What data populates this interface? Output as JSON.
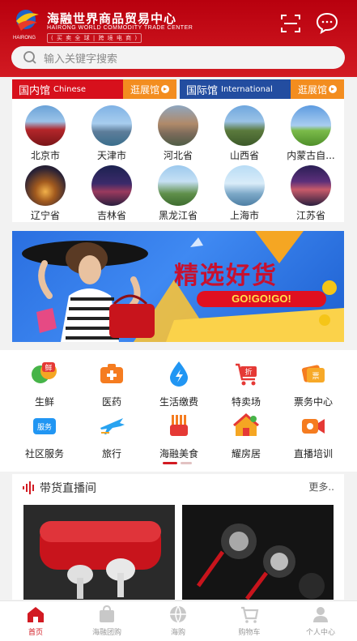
{
  "header": {
    "brand_cn": "海融世界商品贸易中心",
    "brand_en": "HAIRONG WORLD COMMODITY TRADE CENTER",
    "slogan": "( 买 卖 全 球  |  跨 境 电 商 )",
    "logo_text": "HAIRONG"
  },
  "search": {
    "placeholder": "输入关键字搜索"
  },
  "pavilions": {
    "domestic": {
      "name": "国内馆",
      "name_en": "Chinese",
      "action": "逛展馆"
    },
    "international": {
      "name": "国际馆",
      "name_en": "International",
      "action": "逛展馆"
    }
  },
  "cities": [
    {
      "label": "北京市",
      "icon": "tiananmen-photo"
    },
    {
      "label": "天津市",
      "icon": "tianjin-skyline-photo"
    },
    {
      "label": "河北省",
      "icon": "hebei-city-photo"
    },
    {
      "label": "山西省",
      "icon": "shanxi-temple-photo"
    },
    {
      "label": "内蒙古自...",
      "icon": "grassland-photo"
    },
    {
      "label": "辽宁省",
      "icon": "liaoning-night-photo"
    },
    {
      "label": "吉林省",
      "icon": "jilin-night-photo"
    },
    {
      "label": "黑龙江省",
      "icon": "pagoda-photo"
    },
    {
      "label": "上海市",
      "icon": "shanghai-tower-photo"
    },
    {
      "label": "江苏省",
      "icon": "jiangsu-night-photo"
    }
  ],
  "banner": {
    "title": "精选好货",
    "subtitle": "GO!GO!GO!"
  },
  "services": [
    {
      "label": "生鲜",
      "icon": "fresh-food-icon",
      "badge": "鲜"
    },
    {
      "label": "医药",
      "icon": "medicine-icon"
    },
    {
      "label": "生活缴费",
      "icon": "utility-payment-icon"
    },
    {
      "label": "特卖场",
      "icon": "flash-sale-icon",
      "badge": "折"
    },
    {
      "label": "票务中心",
      "icon": "ticket-icon",
      "badge": "票"
    },
    {
      "label": "社区服务",
      "icon": "community-service-icon",
      "badge": "服务"
    },
    {
      "label": "旅行",
      "icon": "airplane-icon"
    },
    {
      "label": "海融美食",
      "icon": "food-icon"
    },
    {
      "label": "耀房居",
      "icon": "house-icon"
    },
    {
      "label": "直播培训",
      "icon": "live-training-icon"
    }
  ],
  "live_section": {
    "title": "带货直播间",
    "more": "更多.."
  },
  "tabbar": [
    {
      "label": "首页",
      "icon": "home-icon",
      "active": true
    },
    {
      "label": "海融团购",
      "icon": "group-buy-icon",
      "active": false
    },
    {
      "label": "海购",
      "icon": "globe-icon",
      "active": false
    },
    {
      "label": "购物车",
      "icon": "cart-icon",
      "active": false
    },
    {
      "label": "个人中心",
      "icon": "user-icon",
      "active": false
    }
  ],
  "colors": {
    "brand_red": "#d21a22",
    "domestic_red": "#d7101c",
    "international_blue": "#234da0",
    "action_orange": "#f38d1f"
  }
}
